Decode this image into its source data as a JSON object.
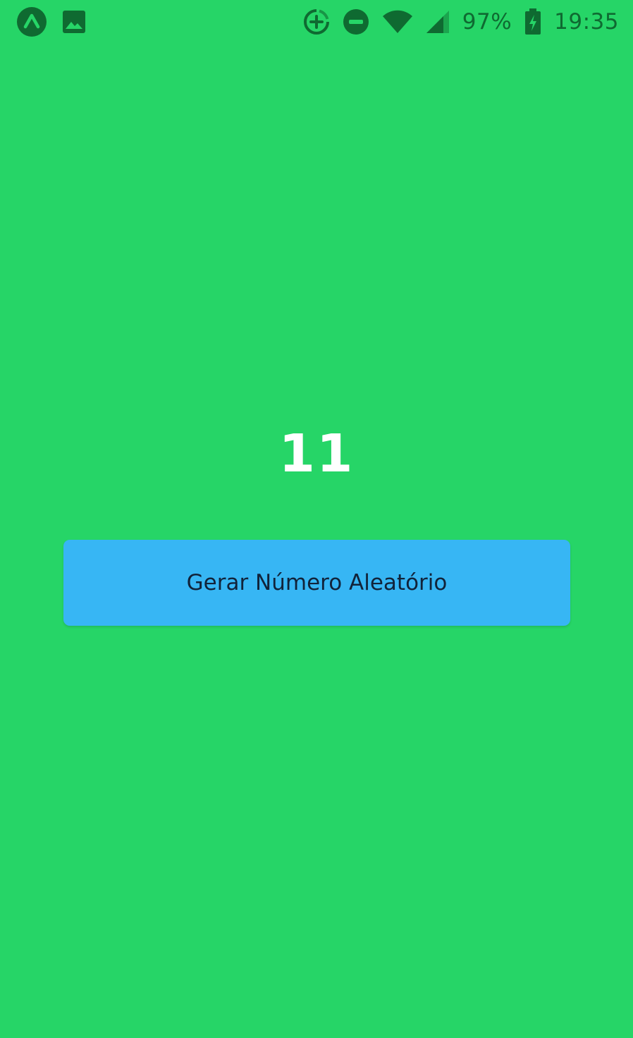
{
  "status_bar": {
    "left_icons": [
      "expo-app-icon",
      "image-icon"
    ],
    "right_icons": [
      "data-saver-icon",
      "do-not-disturb-icon",
      "wifi-icon",
      "cell-signal-icon"
    ],
    "battery_percent": "97%",
    "battery_icon": "battery-charging-icon",
    "time": "19:35",
    "icon_color": "#0f6a31"
  },
  "main": {
    "random_number": "11",
    "generate_button_label": "Gerar Número Aleatório"
  },
  "colors": {
    "background": "#26d567",
    "button": "#37b6f4",
    "number_text": "#ffffff",
    "button_text": "#11233a"
  }
}
